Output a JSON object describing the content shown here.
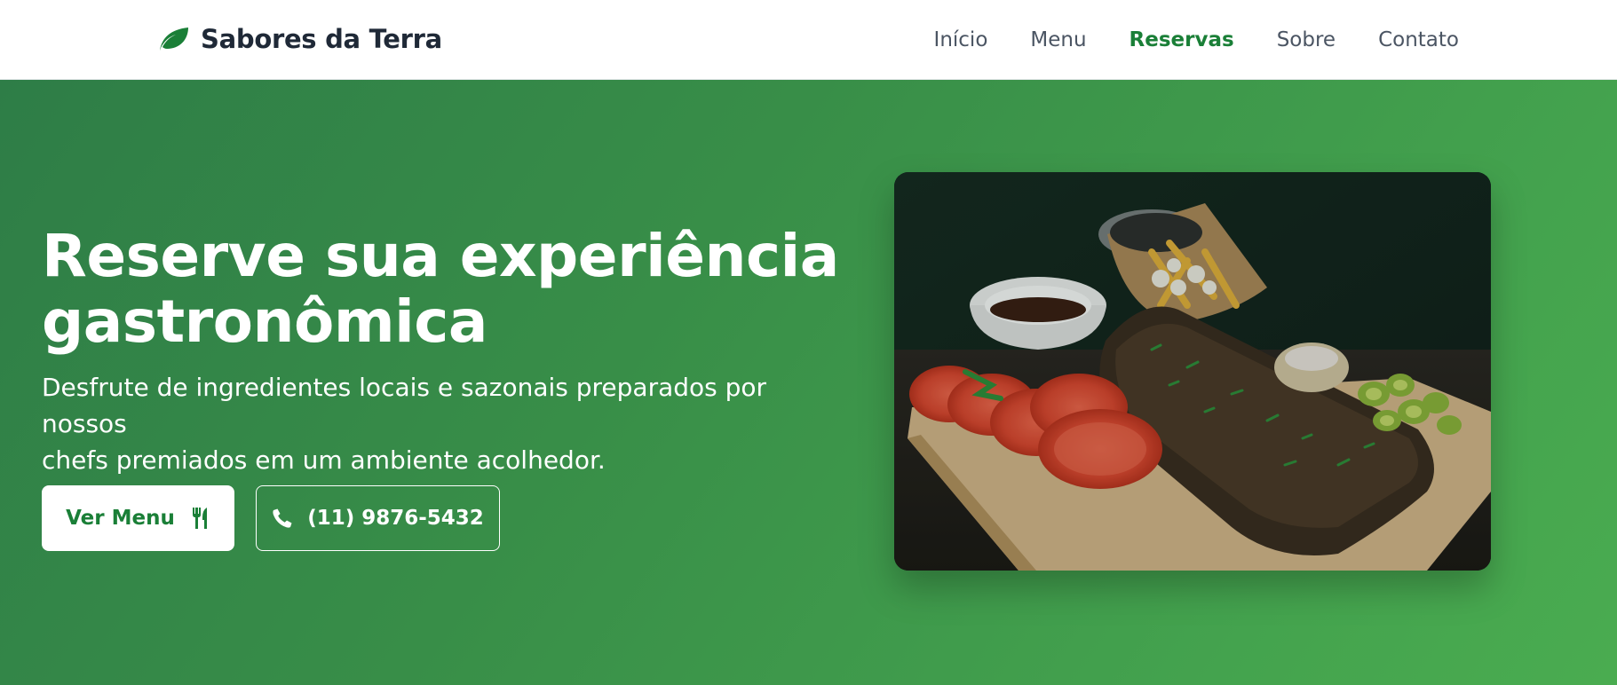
{
  "navbar": {
    "brand": {
      "name": "Sabores da Terra",
      "icon": "leaf-icon"
    },
    "links": [
      {
        "label": "Início",
        "active": false
      },
      {
        "label": "Menu",
        "active": false
      },
      {
        "label": "Reservas",
        "active": true
      },
      {
        "label": "Sobre",
        "active": false
      },
      {
        "label": "Contato",
        "active": false
      }
    ]
  },
  "hero": {
    "title_line1": "Reserve sua experiência",
    "title_line2": "gastronômica",
    "subtitle_line1": "Desfrute de ingredientes locais e sazonais preparados por nossos",
    "subtitle_line2": "chefs premiados em um ambiente acolhedor.",
    "menu_button": {
      "label": "Ver Menu",
      "icon": "utensils-icon"
    },
    "phone_button": {
      "label": "(11) 9876-5432",
      "icon": "phone-icon"
    },
    "image": {
      "subject": "food-photo",
      "alt": ""
    }
  },
  "colors": {
    "brand_green": "#1a7f37",
    "hero_gradient_start": "#2e7d47",
    "hero_gradient_end": "#4aac50",
    "nav_text": "#4b5563",
    "brand_text": "#1f2937"
  }
}
